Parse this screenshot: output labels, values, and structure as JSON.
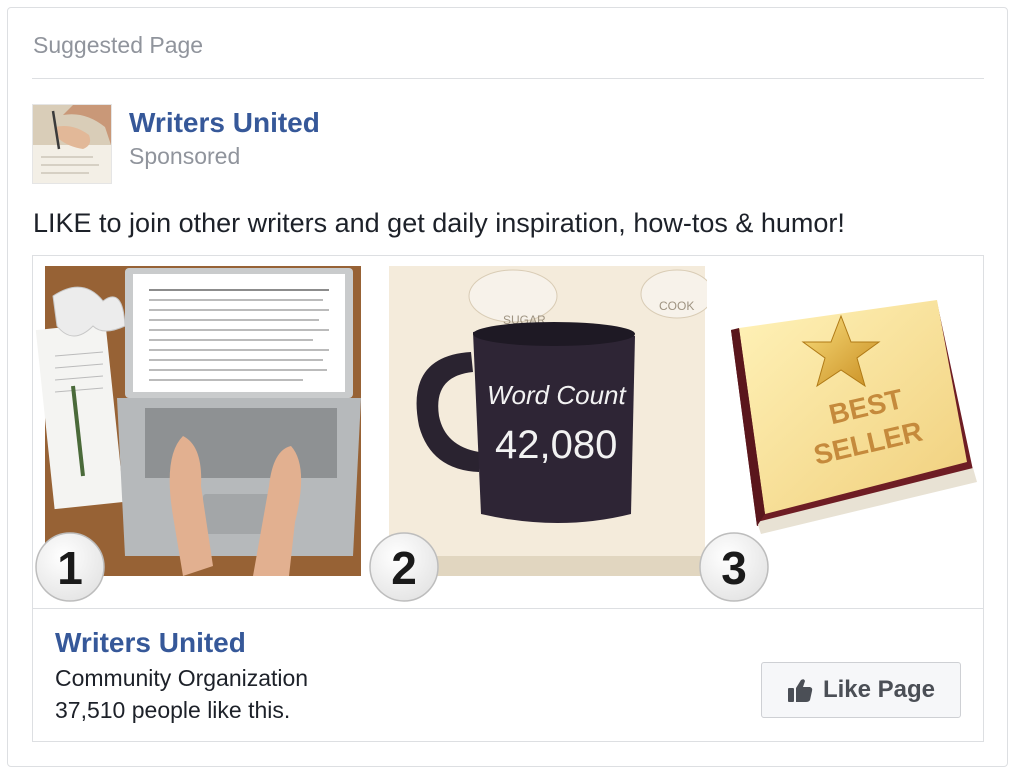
{
  "card": {
    "header_label": "Suggested Page"
  },
  "post": {
    "page_name": "Writers United",
    "sponsored_label": "Sponsored",
    "message": "LIKE to join other writers and get daily inspiration, how-tos & humor!"
  },
  "images": [
    {
      "number": "1",
      "icon": "laptop-typing-image"
    },
    {
      "number": "2",
      "icon": "word-count-mug-image",
      "mug_line1": "Word Count",
      "mug_line2": "42,080",
      "jar_label_left": "SUGAR",
      "jar_label_right": "COOK"
    },
    {
      "number": "3",
      "icon": "best-seller-book-image",
      "book_line1": "BEST",
      "book_line2": "SELLER"
    }
  ],
  "attachment": {
    "page_name": "Writers United",
    "category": "Community Organization",
    "likes_text": "37,510 people like this.",
    "like_button_label": "Like Page",
    "like_button_icon": "thumbs-up-icon"
  },
  "colors": {
    "link_blue": "#365899",
    "muted_gray": "#90949c",
    "text_dark": "#1d2129",
    "border": "#dddfe2"
  }
}
